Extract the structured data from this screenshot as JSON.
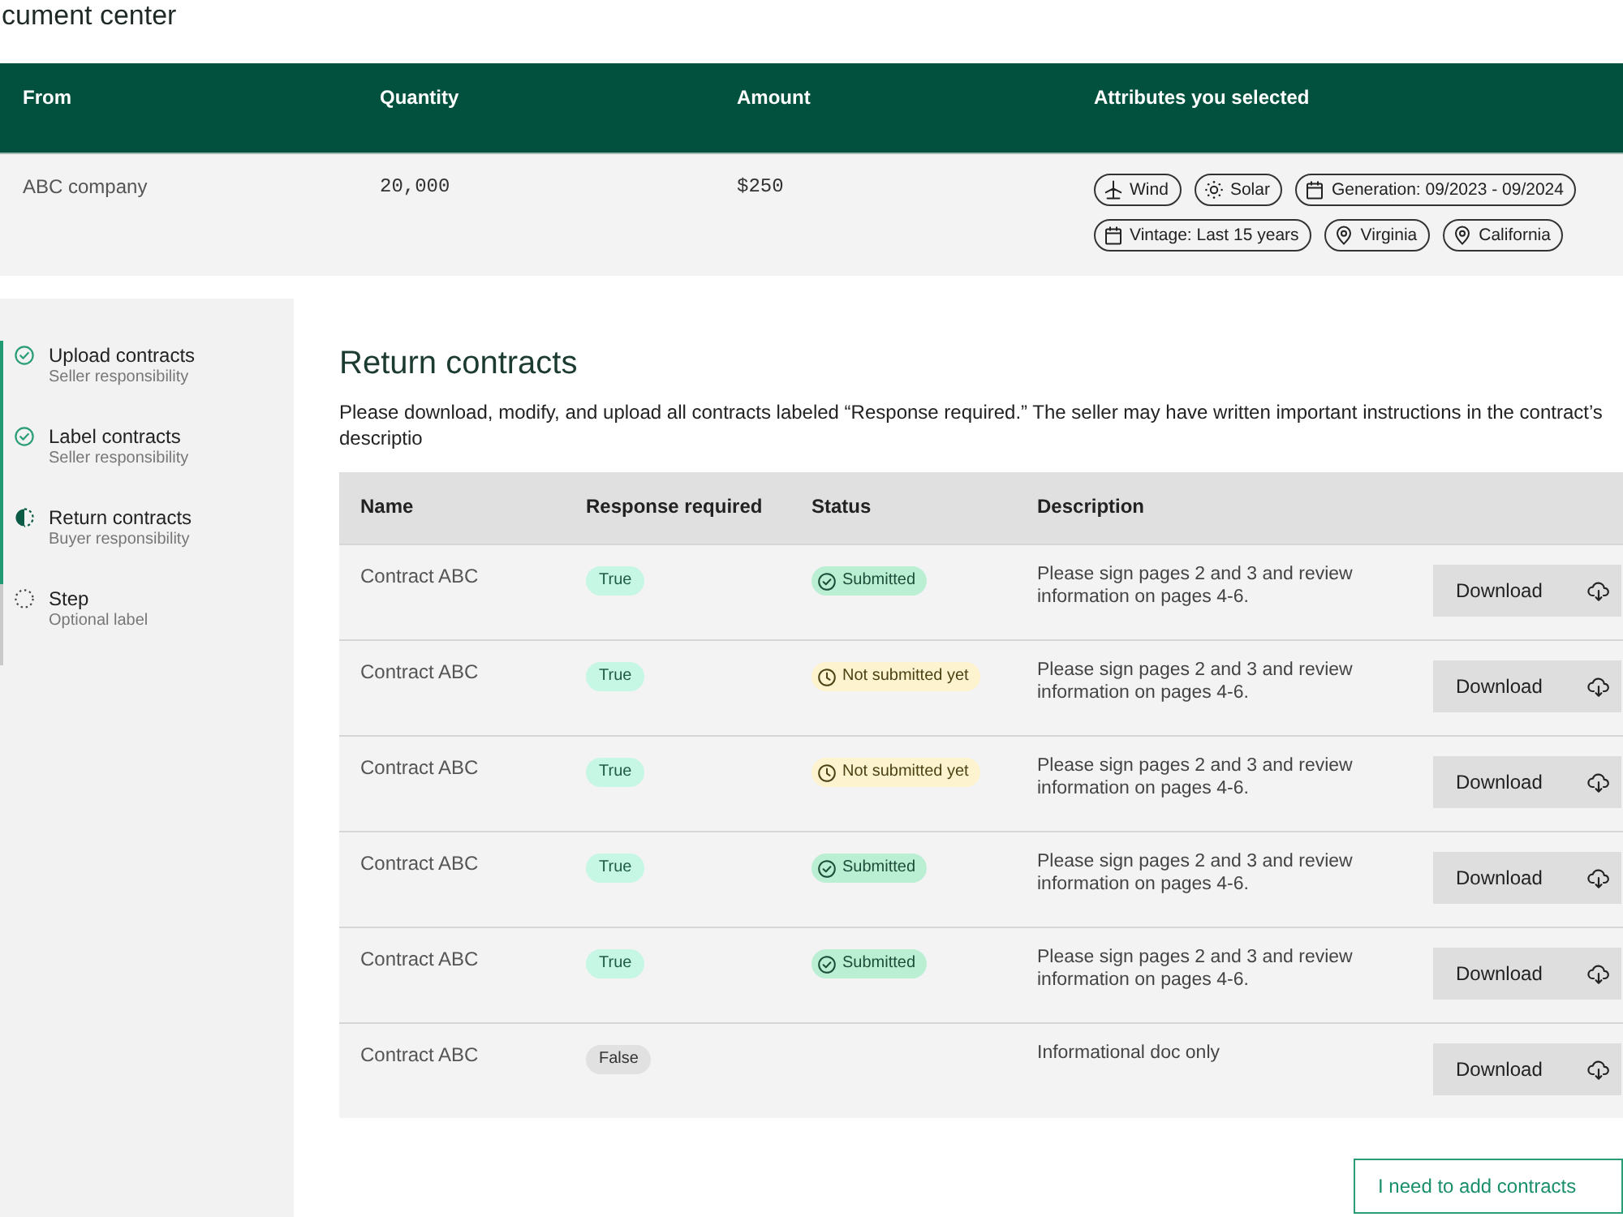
{
  "page": {
    "title": "cument center"
  },
  "summary": {
    "columns": [
      "From",
      "Quantity",
      "Amount",
      "Attributes you selected"
    ],
    "from": "ABC company",
    "quantity": "20,000",
    "amount": "$250",
    "attributes": [
      {
        "kind": "wind",
        "label": "Wind"
      },
      {
        "kind": "solar",
        "label": "Solar"
      },
      {
        "kind": "calendar",
        "label": "Generation: 09/2023 - 09/2024"
      },
      {
        "kind": "calendar",
        "label": "Vintage: Last 15 years"
      },
      {
        "kind": "location",
        "label": "Virginia"
      },
      {
        "kind": "location",
        "label": "California"
      }
    ]
  },
  "steps": [
    {
      "kind": "done",
      "title": "Upload contracts",
      "subtitle": "Seller responsibility"
    },
    {
      "kind": "done",
      "title": "Label contracts",
      "subtitle": "Seller responsibility"
    },
    {
      "kind": "current",
      "title": "Return contracts",
      "subtitle": "Buyer responsibility"
    },
    {
      "kind": "todo",
      "title": "Step",
      "subtitle": "Optional label"
    }
  ],
  "section": {
    "title": "Return contracts",
    "instructions": "Please download, modify, and upload all contracts labeled “Response required.” The seller may have written important instructions in the contract’s descriptio"
  },
  "contracts": {
    "columns": [
      "Name",
      "Response required",
      "Status",
      "Description"
    ],
    "rows": [
      {
        "name": "Contract ABC",
        "response": {
          "label": "True",
          "required": true
        },
        "status": {
          "kind": "submitted",
          "label": "Submitted"
        },
        "description": "Please sign pages 2 and 3 and review information on pages 4-6.",
        "action": "Download"
      },
      {
        "name": "Contract ABC",
        "response": {
          "label": "True",
          "required": true
        },
        "status": {
          "kind": "not_submitted",
          "label": "Not submitted yet"
        },
        "description": "Please sign pages 2 and 3 and review information on pages 4-6.",
        "action": "Download"
      },
      {
        "name": "Contract ABC",
        "response": {
          "label": "True",
          "required": true
        },
        "status": {
          "kind": "not_submitted",
          "label": "Not submitted yet"
        },
        "description": "Please sign pages 2 and 3 and review information on pages 4-6.",
        "action": "Download"
      },
      {
        "name": "Contract ABC",
        "response": {
          "label": "True",
          "required": true
        },
        "status": {
          "kind": "submitted",
          "label": "Submitted"
        },
        "description": "Please sign pages 2 and 3 and review information on pages 4-6.",
        "action": "Download"
      },
      {
        "name": "Contract ABC",
        "response": {
          "label": "True",
          "required": true
        },
        "status": {
          "kind": "submitted",
          "label": "Submitted"
        },
        "description": "Please sign pages 2 and 3 and review information on pages 4-6.",
        "action": "Download"
      },
      {
        "name": "Contract ABC",
        "response": {
          "label": "False",
          "required": false
        },
        "description": "Informational doc only",
        "action": "Download"
      }
    ]
  },
  "add_button": "I need to add contracts"
}
